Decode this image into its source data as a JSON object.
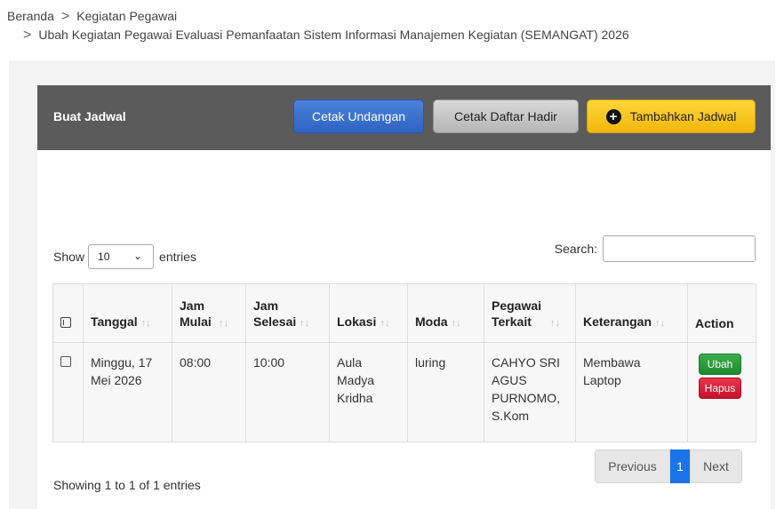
{
  "breadcrumb": {
    "items": [
      "Beranda",
      "Kegiatan Pegawai",
      "Ubah Kegiatan Pegawai Evaluasi Pemanfaatan Sistem Informasi Manajemen Kegiatan (SEMANGAT) 2026"
    ],
    "separator": ">"
  },
  "card": {
    "title": "Buat Jadwal",
    "buttons": {
      "print_invitation": "Cetak Undangan",
      "print_attendance": "Cetak Daftar Hadir",
      "add_schedule": "Tambahkan Jadwal"
    }
  },
  "length_control": {
    "prefix": "Show",
    "value": "10",
    "suffix": "entries"
  },
  "search": {
    "label": "Search:",
    "value": ""
  },
  "table": {
    "columns": [
      "Tanggal",
      "Jam Mulai",
      "Jam Selesai",
      "Lokasi",
      "Moda",
      "Pegawai Terkait",
      "Keterangan",
      "Action"
    ],
    "rows": [
      {
        "tanggal": "Minggu, 17 Mei 2026",
        "jam_mulai": "08:00",
        "jam_selesai": "10:00",
        "lokasi": "Aula Madya Kridha",
        "moda": "luring",
        "pegawai": "CAHYO SRI AGUS PURNOMO, S.Kom",
        "keterangan": "Membawa Laptop",
        "actions": {
          "edit": "Ubah",
          "delete": "Hapus"
        }
      }
    ]
  },
  "footer": {
    "info": "Showing 1 to 1 of 1 entries",
    "pagination": {
      "previous": "Previous",
      "current": "1",
      "next": "Next"
    }
  },
  "colors": {
    "card_header": "#5b5b5b",
    "blue_button": "#3b72d0",
    "yellow_button": "#f5c218",
    "edit_button": "#2e9e3e",
    "delete_button": "#dc1e38",
    "page_active": "#1a73e8"
  }
}
